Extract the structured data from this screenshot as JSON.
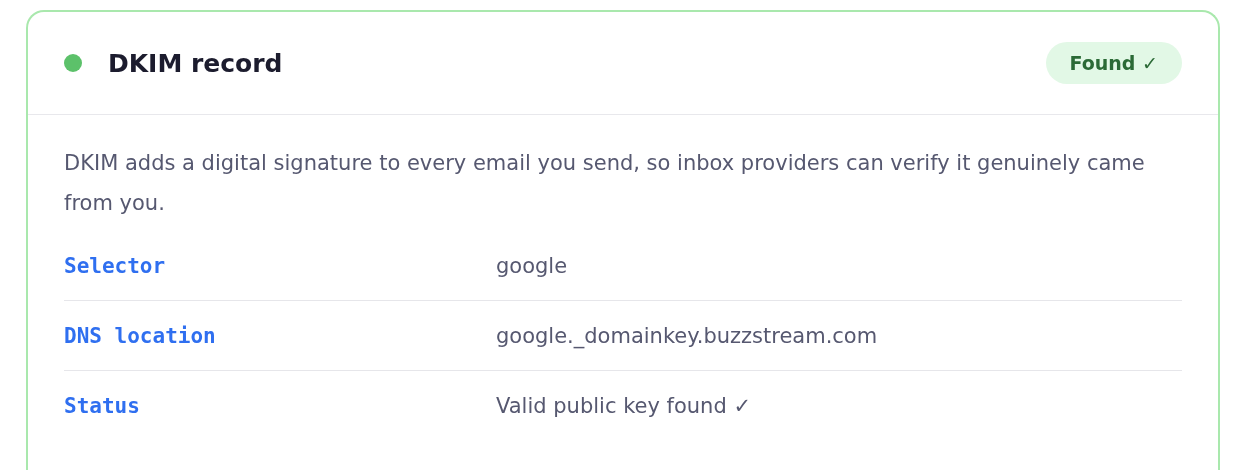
{
  "card": {
    "title": "DKIM record",
    "found": true,
    "badge": "Found ✓",
    "description": "DKIM adds a digital signature to every email you send, so inbox providers can verify it genuinely came from you.",
    "rows": [
      {
        "label": "Selector",
        "value": "google"
      },
      {
        "label": "DNS location",
        "value": "google._domainkey.buzzstream.com"
      },
      {
        "label": "Status",
        "value": "Valid public key found ✓"
      }
    ]
  }
}
